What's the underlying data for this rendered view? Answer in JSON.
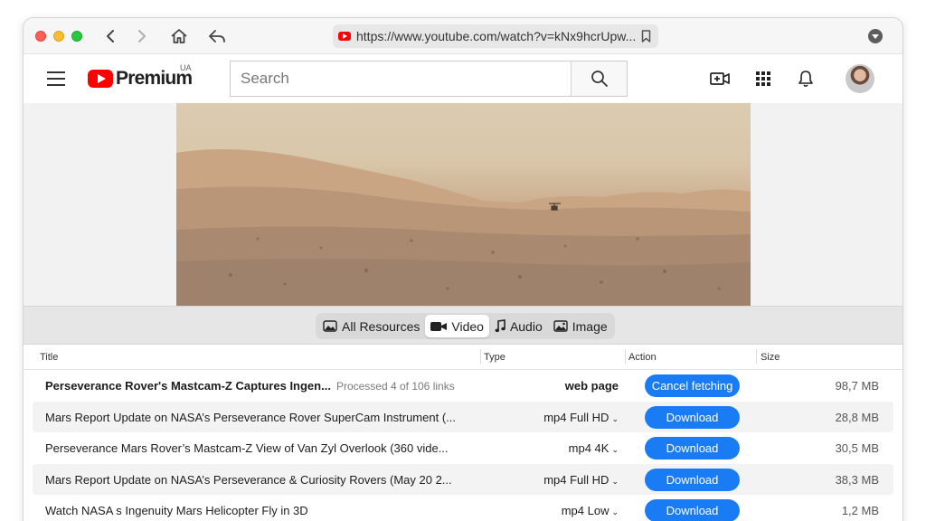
{
  "browser": {
    "url": "https://www.youtube.com/watch?v=kNx9hcrUpw..."
  },
  "youtube": {
    "brand": "Premium",
    "region": "UA",
    "search_placeholder": "Search"
  },
  "tabs": [
    {
      "label": "All Resources",
      "icon": "photos-icon",
      "active": false
    },
    {
      "label": "Video",
      "icon": "video-camera-icon",
      "active": true
    },
    {
      "label": "Audio",
      "icon": "music-note-icon",
      "active": false
    },
    {
      "label": "Image",
      "icon": "image-icon",
      "active": false
    }
  ],
  "table": {
    "columns": [
      "Title",
      "Type",
      "Action",
      "Size"
    ],
    "rows": [
      {
        "title": "Perseverance Rover's Mastcam-Z Captures Ingen...",
        "sub": "Processed 4 of 106 links",
        "type": "web page",
        "action": "Cancel fetching",
        "size": "98,7 MB"
      },
      {
        "title": "Mars Report  Update on NASA’s Perseverance Rover SuperCam Instrument (...",
        "type": "mp4 Full HD",
        "action": "Download",
        "size": "28,8 MB"
      },
      {
        "title": "Perseverance Mars Rover’s Mastcam-Z View of  Van Zyl Overlook  (360 vide...",
        "type": "mp4 4K",
        "action": "Download",
        "size": "30,5 MB"
      },
      {
        "title": "Mars Report  Update on NASA’s Perseverance & Curiosity Rovers (May 20  2...",
        "type": "mp4 Full HD",
        "action": "Download",
        "size": "38,3 MB"
      },
      {
        "title": "Watch NASA s Ingenuity Mars Helicopter Fly in 3D",
        "type": "mp4 Low",
        "action": "Download",
        "size": "1,2 MB"
      }
    ]
  },
  "colors": {
    "accent": "#1a7cf5",
    "youtube_red": "#ff0000"
  }
}
